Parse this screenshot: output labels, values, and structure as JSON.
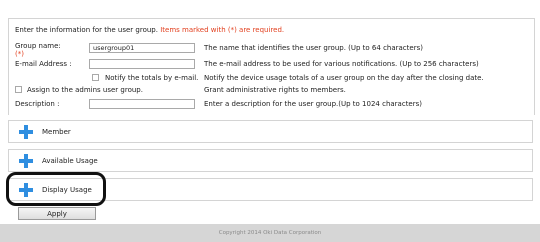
{
  "form": {
    "intro": "Enter the information for the user group.",
    "intro_required": "Items marked with (*) are required.",
    "group_name": {
      "label": "Group name:",
      "required_mark": "(*)",
      "value": "usergroup01",
      "description": "The name that identifies the user group. (Up to 64 characters)"
    },
    "email": {
      "label": "E-mail Address :",
      "value": "",
      "description": "The e-mail address to be used for various notifications. (Up to 256 characters)"
    },
    "notify": {
      "label": "Notify the totals by e-mail.",
      "checked": false,
      "description": "Notify the device usage totals of a user group on the day after the closing date."
    },
    "assign_admin": {
      "label": "Assign to the admins user group.",
      "checked": false,
      "description": "Grant administrative rights to members."
    },
    "description_field": {
      "label": "Description :",
      "value": "",
      "description": "Enter a description for the user group.(Up to 1024 characters)"
    }
  },
  "sections": [
    {
      "label": "Member",
      "icon": "plus-icon"
    },
    {
      "label": "Available Usage",
      "icon": "plus-icon"
    },
    {
      "label": "Display Usage",
      "icon": "plus-icon"
    }
  ],
  "apply_label": "Apply",
  "footer": "Copyright 2014 Oki Data Corporation",
  "colors": {
    "required": "#e2401f",
    "plus_icon": "#2f8ee0",
    "footer_bg": "#d6d6d6"
  }
}
